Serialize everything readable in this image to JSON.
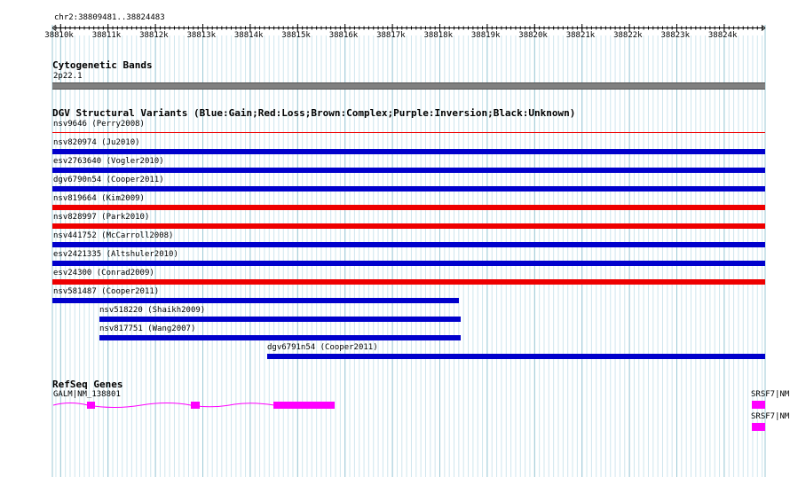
{
  "ruler": {
    "locus": "chr2:38809481..38824483",
    "ticks": [
      "38810k",
      "38811k",
      "38812k",
      "38813k",
      "38814k",
      "38815k",
      "38816k",
      "38817k",
      "38818k",
      "38819k",
      "38820k",
      "38821k",
      "38822k",
      "38823k",
      "38824k"
    ]
  },
  "cytoband": {
    "title": "Cytogenetic Bands",
    "band": "2p22.1"
  },
  "dgv": {
    "title": "DGV Structural Variants (Blue:Gain;Red:Loss;Brown:Complex;Purple:Inversion;Black:Unknown)",
    "colors": {
      "gain": "#0000cc",
      "loss": "#ee0000"
    },
    "variants": [
      {
        "label": "nsv9646 (Perry2008)",
        "type": "loss"
      },
      {
        "label": "nsv820974 (Ju2010)",
        "type": "gain"
      },
      {
        "label": "esv2763640 (Vogler2010)",
        "type": "gain"
      },
      {
        "label": "dgv6790n54 (Cooper2011)",
        "type": "gain"
      },
      {
        "label": "nsv819664 (Kim2009)",
        "type": "loss"
      },
      {
        "label": "nsv828997 (Park2010)",
        "type": "loss"
      },
      {
        "label": "nsv441752 (McCarroll2008)",
        "type": "gain"
      },
      {
        "label": "esv2421335 (Altshuler2010)",
        "type": "gain"
      },
      {
        "label": "esv24300 (Conrad2009)",
        "type": "loss"
      },
      {
        "label": "nsv581487 (Cooper2011)",
        "type": "gain"
      },
      {
        "label": "nsv518220 (Shaikh2009)",
        "type": "gain"
      },
      {
        "label": "nsv817751 (Wang2007)",
        "type": "gain"
      },
      {
        "label": "dgv6791n54 (Cooper2011)",
        "type": "gain"
      }
    ]
  },
  "refseq": {
    "title": "RefSeq Genes",
    "color": "#ff00ff",
    "genes": [
      "GALM|NM_138801",
      "SRSF7|NM",
      "SRSF7|NM"
    ]
  }
}
